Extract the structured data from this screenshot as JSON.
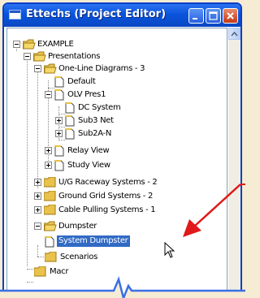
{
  "window": {
    "title": "Ettechs (Project Editor)",
    "colors": {
      "titlebar": "#0a54dd",
      "selection": "#316ac5",
      "annotation": "#e01a1a",
      "backdrop": "#f6ecd4"
    }
  },
  "tree": {
    "nodes": [
      {
        "label": "EXAMPLE",
        "icon": "folder-icon",
        "state": "expanded"
      },
      {
        "label": "Presentations",
        "icon": "folder-icon",
        "state": "expanded"
      },
      {
        "label": "One-Line Diagrams - 3",
        "icon": "folder-icon",
        "state": "expanded"
      },
      {
        "label": "Default",
        "icon": "document-icon",
        "state": "leaf"
      },
      {
        "label": "OLV Pres1",
        "icon": "document-icon",
        "state": "expanded"
      },
      {
        "label": "DC System",
        "icon": "document-icon",
        "state": "leaf"
      },
      {
        "label": "Sub3 Net",
        "icon": "document-icon",
        "state": "collapsed"
      },
      {
        "label": "Sub2A-N",
        "icon": "document-icon",
        "state": "collapsed"
      },
      {
        "label": "Relay View",
        "icon": "document-icon",
        "state": "collapsed"
      },
      {
        "label": "Study View",
        "icon": "document-icon",
        "state": "collapsed"
      },
      {
        "label": "U/G Raceway Systems - 2",
        "icon": "folder-icon",
        "state": "collapsed"
      },
      {
        "label": "Ground Grid Systems - 2",
        "icon": "folder-icon",
        "state": "collapsed"
      },
      {
        "label": "Cable Pulling Systems - 1",
        "icon": "folder-icon",
        "state": "collapsed"
      },
      {
        "label": "Dumpster",
        "icon": "folder-icon",
        "state": "expanded"
      },
      {
        "label": "System Dumpster",
        "icon": "document-icon",
        "state": "leaf",
        "selected": true
      },
      {
        "label": "Scenarios",
        "icon": "folder-icon",
        "state": "leaf"
      },
      {
        "label": "Macr",
        "icon": "folder-icon",
        "state": "leaf"
      }
    ]
  }
}
